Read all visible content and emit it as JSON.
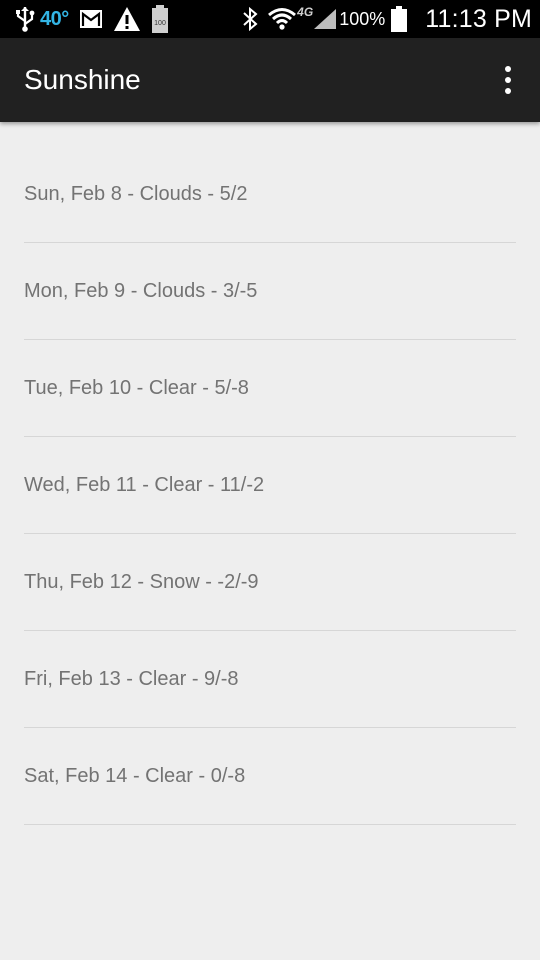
{
  "status_bar": {
    "temperature": "40°",
    "network": "4G",
    "battery_percent": "100%",
    "time": "11:13 PM",
    "battery_notification_text": "100",
    "icons": [
      "usb-icon",
      "gmail-icon",
      "warning-icon",
      "battery-notification-icon",
      "bluetooth-icon",
      "wifi-icon",
      "signal-icon",
      "battery-icon"
    ]
  },
  "app_bar": {
    "title": "Sunshine",
    "overflow_icon": "more-vert-icon"
  },
  "forecast": [
    {
      "text": "Sun, Feb 8 - Clouds - 5/2"
    },
    {
      "text": "Mon, Feb 9 - Clouds - 3/-5"
    },
    {
      "text": "Tue, Feb 10 - Clear - 5/-8"
    },
    {
      "text": "Wed, Feb 11 - Clear - 11/-2"
    },
    {
      "text": "Thu, Feb 12 - Snow - -2/-9"
    },
    {
      "text": "Fri, Feb 13 - Clear - 9/-8"
    },
    {
      "text": "Sat, Feb 14 - Clear - 0/-8"
    }
  ],
  "colors": {
    "app_bar": "#212121",
    "status_bar": "#000000",
    "background": "#eeeeee",
    "list_text": "#737373",
    "temp_accent": "#33b5e5"
  }
}
